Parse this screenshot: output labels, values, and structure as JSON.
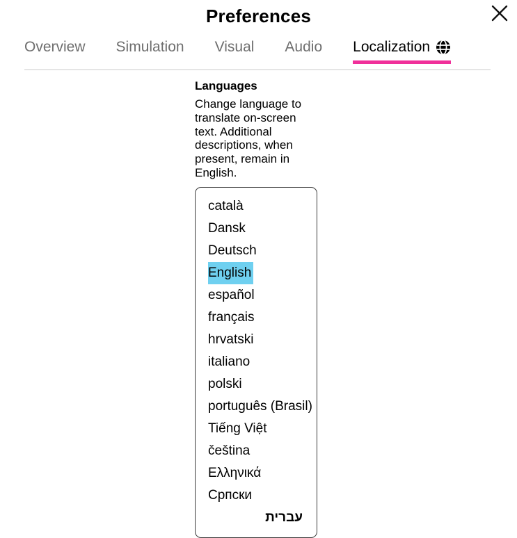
{
  "dialog": {
    "title": "Preferences",
    "close_icon": "close-icon"
  },
  "tabs": [
    {
      "label": "Overview",
      "active": false
    },
    {
      "label": "Simulation",
      "active": false
    },
    {
      "label": "Visual",
      "active": false
    },
    {
      "label": "Audio",
      "active": false
    },
    {
      "label": "Localization",
      "active": true,
      "icon": "globe-icon"
    }
  ],
  "main": {
    "section_title": "Languages",
    "section_description": "Change language to translate on-screen text. Additional descriptions, when present, remain in English."
  },
  "language_list": {
    "selected": "English",
    "items": [
      {
        "label": "català",
        "rtl": false
      },
      {
        "label": "Dansk",
        "rtl": false
      },
      {
        "label": "Deutsch",
        "rtl": false
      },
      {
        "label": "English",
        "rtl": false
      },
      {
        "label": "español",
        "rtl": false
      },
      {
        "label": "français",
        "rtl": false
      },
      {
        "label": "hrvatski",
        "rtl": false
      },
      {
        "label": "italiano",
        "rtl": false
      },
      {
        "label": "polski",
        "rtl": false
      },
      {
        "label": "português (Brasil)",
        "rtl": false
      },
      {
        "label": "Tiếng Việt",
        "rtl": false
      },
      {
        "label": "čeština",
        "rtl": false
      },
      {
        "label": "Ελληνικά",
        "rtl": false
      },
      {
        "label": "Српски",
        "rtl": false
      },
      {
        "label": "עברית",
        "rtl": true
      }
    ]
  },
  "colors": {
    "accent_underline": "#f0309a",
    "selection_highlight": "#6fd0f0",
    "inactive_tab_text": "#6e6e6e",
    "divider": "#c9c9c9"
  }
}
